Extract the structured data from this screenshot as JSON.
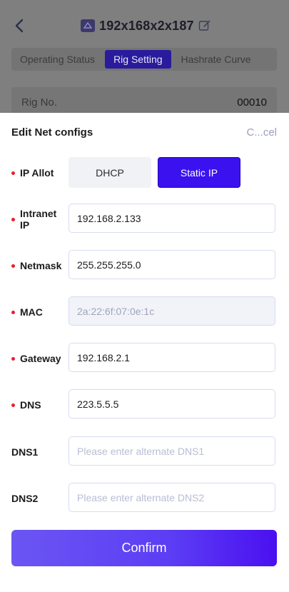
{
  "header": {
    "title": "192x168x2x187",
    "back_icon": "chevron-left-icon",
    "chip_icon": "gpu-chip-icon",
    "edit_icon": "edit-pencil-icon"
  },
  "tabs": [
    {
      "label": "Operating Status",
      "active": false
    },
    {
      "label": "Rig Setting",
      "active": true
    },
    {
      "label": "Hashrate Curve",
      "active": false
    }
  ],
  "rig": {
    "label": "Rig No.",
    "value": "00010"
  },
  "sheet": {
    "title": "Edit Net configs",
    "cancel_label": "C...cel",
    "ip_allot": {
      "label": "IP Allot",
      "options": [
        "DHCP",
        "Static IP"
      ],
      "selected": "Static IP"
    },
    "fields": {
      "intranet_ip": {
        "label": "Intranet IP",
        "value": "192.168.2.133",
        "placeholder": ""
      },
      "netmask": {
        "label": "Netmask",
        "value": "255.255.255.0",
        "placeholder": ""
      },
      "mac": {
        "label": "MAC",
        "value": "2a:22:6f:07:0e:1c",
        "placeholder": ""
      },
      "gateway": {
        "label": "Gateway",
        "value": "192.168.2.1",
        "placeholder": ""
      },
      "dns": {
        "label": "DNS",
        "value": "223.5.5.5",
        "placeholder": ""
      },
      "dns1": {
        "label": "DNS1",
        "value": "",
        "placeholder": "Please enter alternate DNS1"
      },
      "dns2": {
        "label": "DNS2",
        "value": "",
        "placeholder": "Please enter alternate DNS2"
      }
    },
    "confirm_label": "Confirm"
  },
  "colors": {
    "accent": "#3b12ef",
    "required_dot": "#e8202f"
  }
}
